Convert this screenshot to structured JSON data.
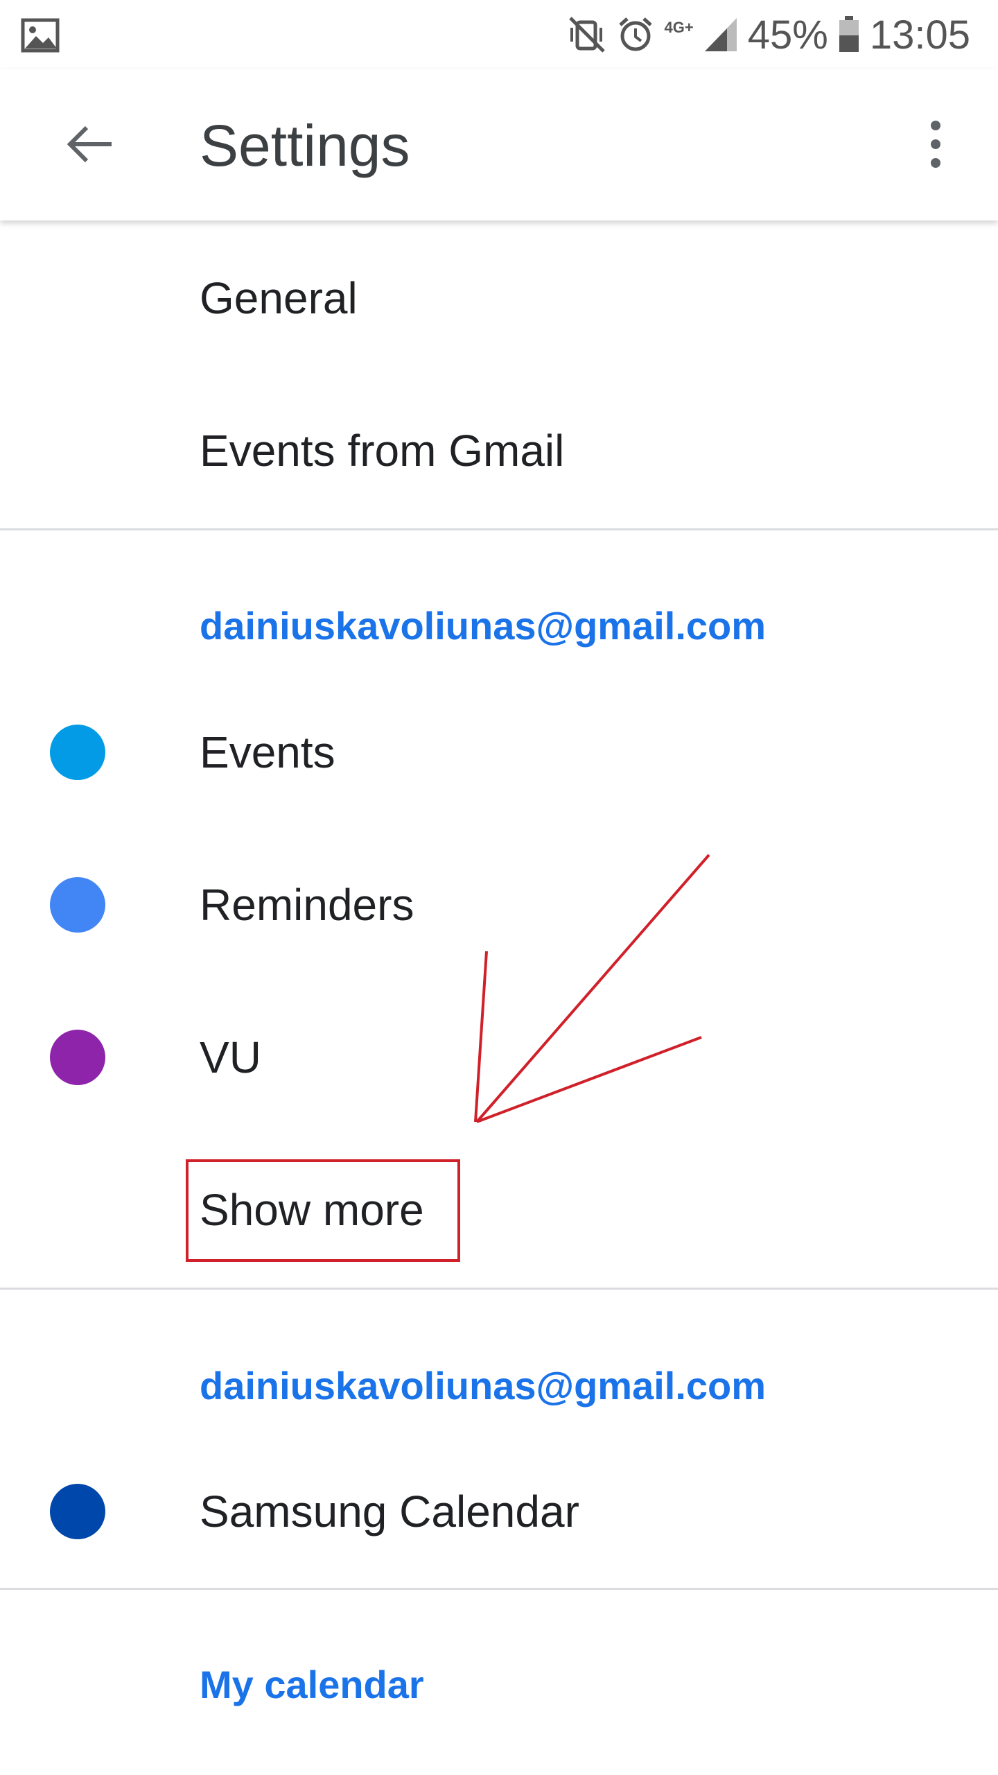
{
  "status_bar": {
    "battery": "45%",
    "time": "13:05",
    "network": "4G+"
  },
  "toolbar": {
    "title": "Settings"
  },
  "sections": {
    "general": "General",
    "events_from_gmail": "Events from Gmail",
    "account1": {
      "email": "dainiuskavoliunas@gmail.com",
      "calendars": [
        {
          "label": "Events",
          "color": "#039be5"
        },
        {
          "label": "Reminders",
          "color": "#4285f4"
        },
        {
          "label": "VU",
          "color": "#8e24aa"
        }
      ],
      "show_more": "Show more"
    },
    "account2": {
      "email": "dainiuskavoliunas@gmail.com",
      "calendars": [
        {
          "label": "Samsung Calendar",
          "color": "#0047ab"
        }
      ]
    },
    "my_calendar": "My calendar"
  },
  "annotation": {
    "color": "#d0202a"
  }
}
